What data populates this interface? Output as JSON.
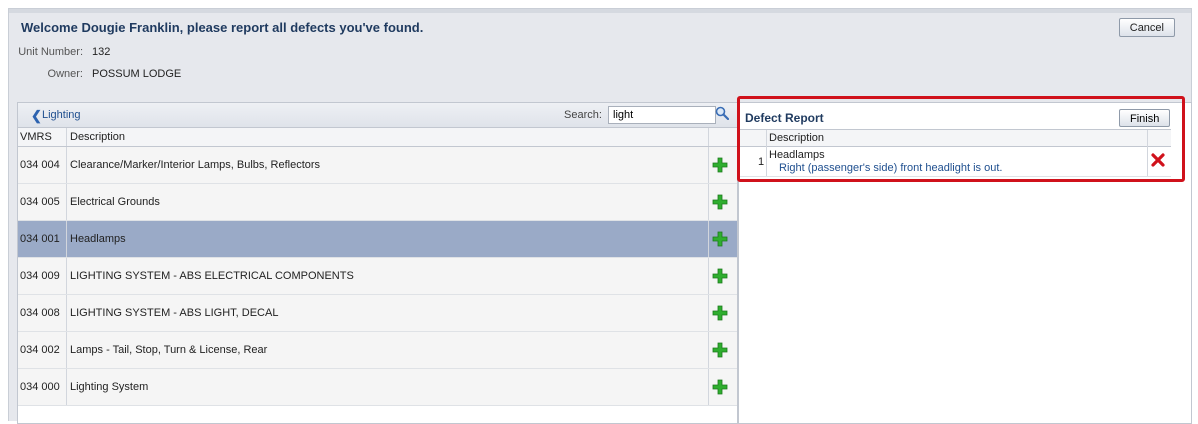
{
  "header": {
    "welcome": "Welcome Dougie Franklin, please report all defects you've found.",
    "cancel_label": "Cancel",
    "unit_label": "Unit Number:",
    "unit_value": "132",
    "owner_label": "Owner:",
    "owner_value": "POSSUM LODGE"
  },
  "left": {
    "back_label": "Lighting",
    "search_label": "Search:",
    "search_value": "light",
    "columns": [
      "VMRS",
      "Description"
    ],
    "rows": [
      {
        "vmrs": "034  004",
        "desc": "Clearance/Marker/Interior Lamps, Bulbs, Reflectors",
        "selected": false
      },
      {
        "vmrs": "034  005",
        "desc": "Electrical Grounds",
        "selected": false
      },
      {
        "vmrs": "034  001",
        "desc": "Headlamps",
        "selected": true
      },
      {
        "vmrs": "034  009",
        "desc": "LIGHTING SYSTEM - ABS ELECTRICAL COMPONENTS",
        "selected": false
      },
      {
        "vmrs": "034  008",
        "desc": "LIGHTING SYSTEM - ABS LIGHT, DECAL",
        "selected": false
      },
      {
        "vmrs": "034  002",
        "desc": "Lamps - Tail, Stop, Turn & License, Rear",
        "selected": false
      },
      {
        "vmrs": "034  000",
        "desc": "Lighting System",
        "selected": false
      }
    ]
  },
  "defect_report": {
    "title": "Defect Report",
    "finish_label": "Finish",
    "column": "Description",
    "items": [
      {
        "num": "1",
        "title": "Headlamps",
        "detail": "Right (passenger's side) front headlight is out."
      }
    ]
  },
  "colors": {
    "selected_row": "#9aaac7",
    "highlight": "#d0111b",
    "add_icon": "#2fae2f",
    "delete_icon": "#d0111b"
  }
}
